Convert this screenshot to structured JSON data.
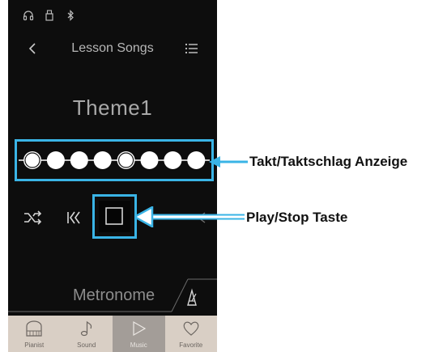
{
  "status_icons": [
    "headphones-icon",
    "usb-icon",
    "bluetooth-icon"
  ],
  "header": {
    "title": "Lesson Songs",
    "back_icon": "chevron-left-icon",
    "menu_icon": "list-icon"
  },
  "song": {
    "title": "Theme1"
  },
  "beat_indicator": {
    "beats": 8,
    "accented_beats": [
      1,
      5
    ]
  },
  "transport": {
    "shuffle_icon": "shuffle-icon",
    "previous_icon": "skip-back-icon",
    "play_stop_icon": "stop-square-icon"
  },
  "metronome": {
    "label": "Metronome",
    "icon": "metronome-icon"
  },
  "tabs": [
    {
      "label": "Pianist",
      "icon": "piano-icon",
      "active": false
    },
    {
      "label": "Sound",
      "icon": "music-note-icon",
      "active": false
    },
    {
      "label": "Music",
      "icon": "play-icon",
      "active": true
    },
    {
      "label": "Favorite",
      "icon": "heart-icon",
      "active": false
    }
  ],
  "callouts": {
    "beat": "Takt/Taktschlag Anzeige",
    "play_stop": "Play/Stop Taste"
  },
  "colors": {
    "highlight": "#3ab4e6",
    "screen_bg": "#0d0d0d",
    "tabbar_bg": "#d9cfc5"
  }
}
